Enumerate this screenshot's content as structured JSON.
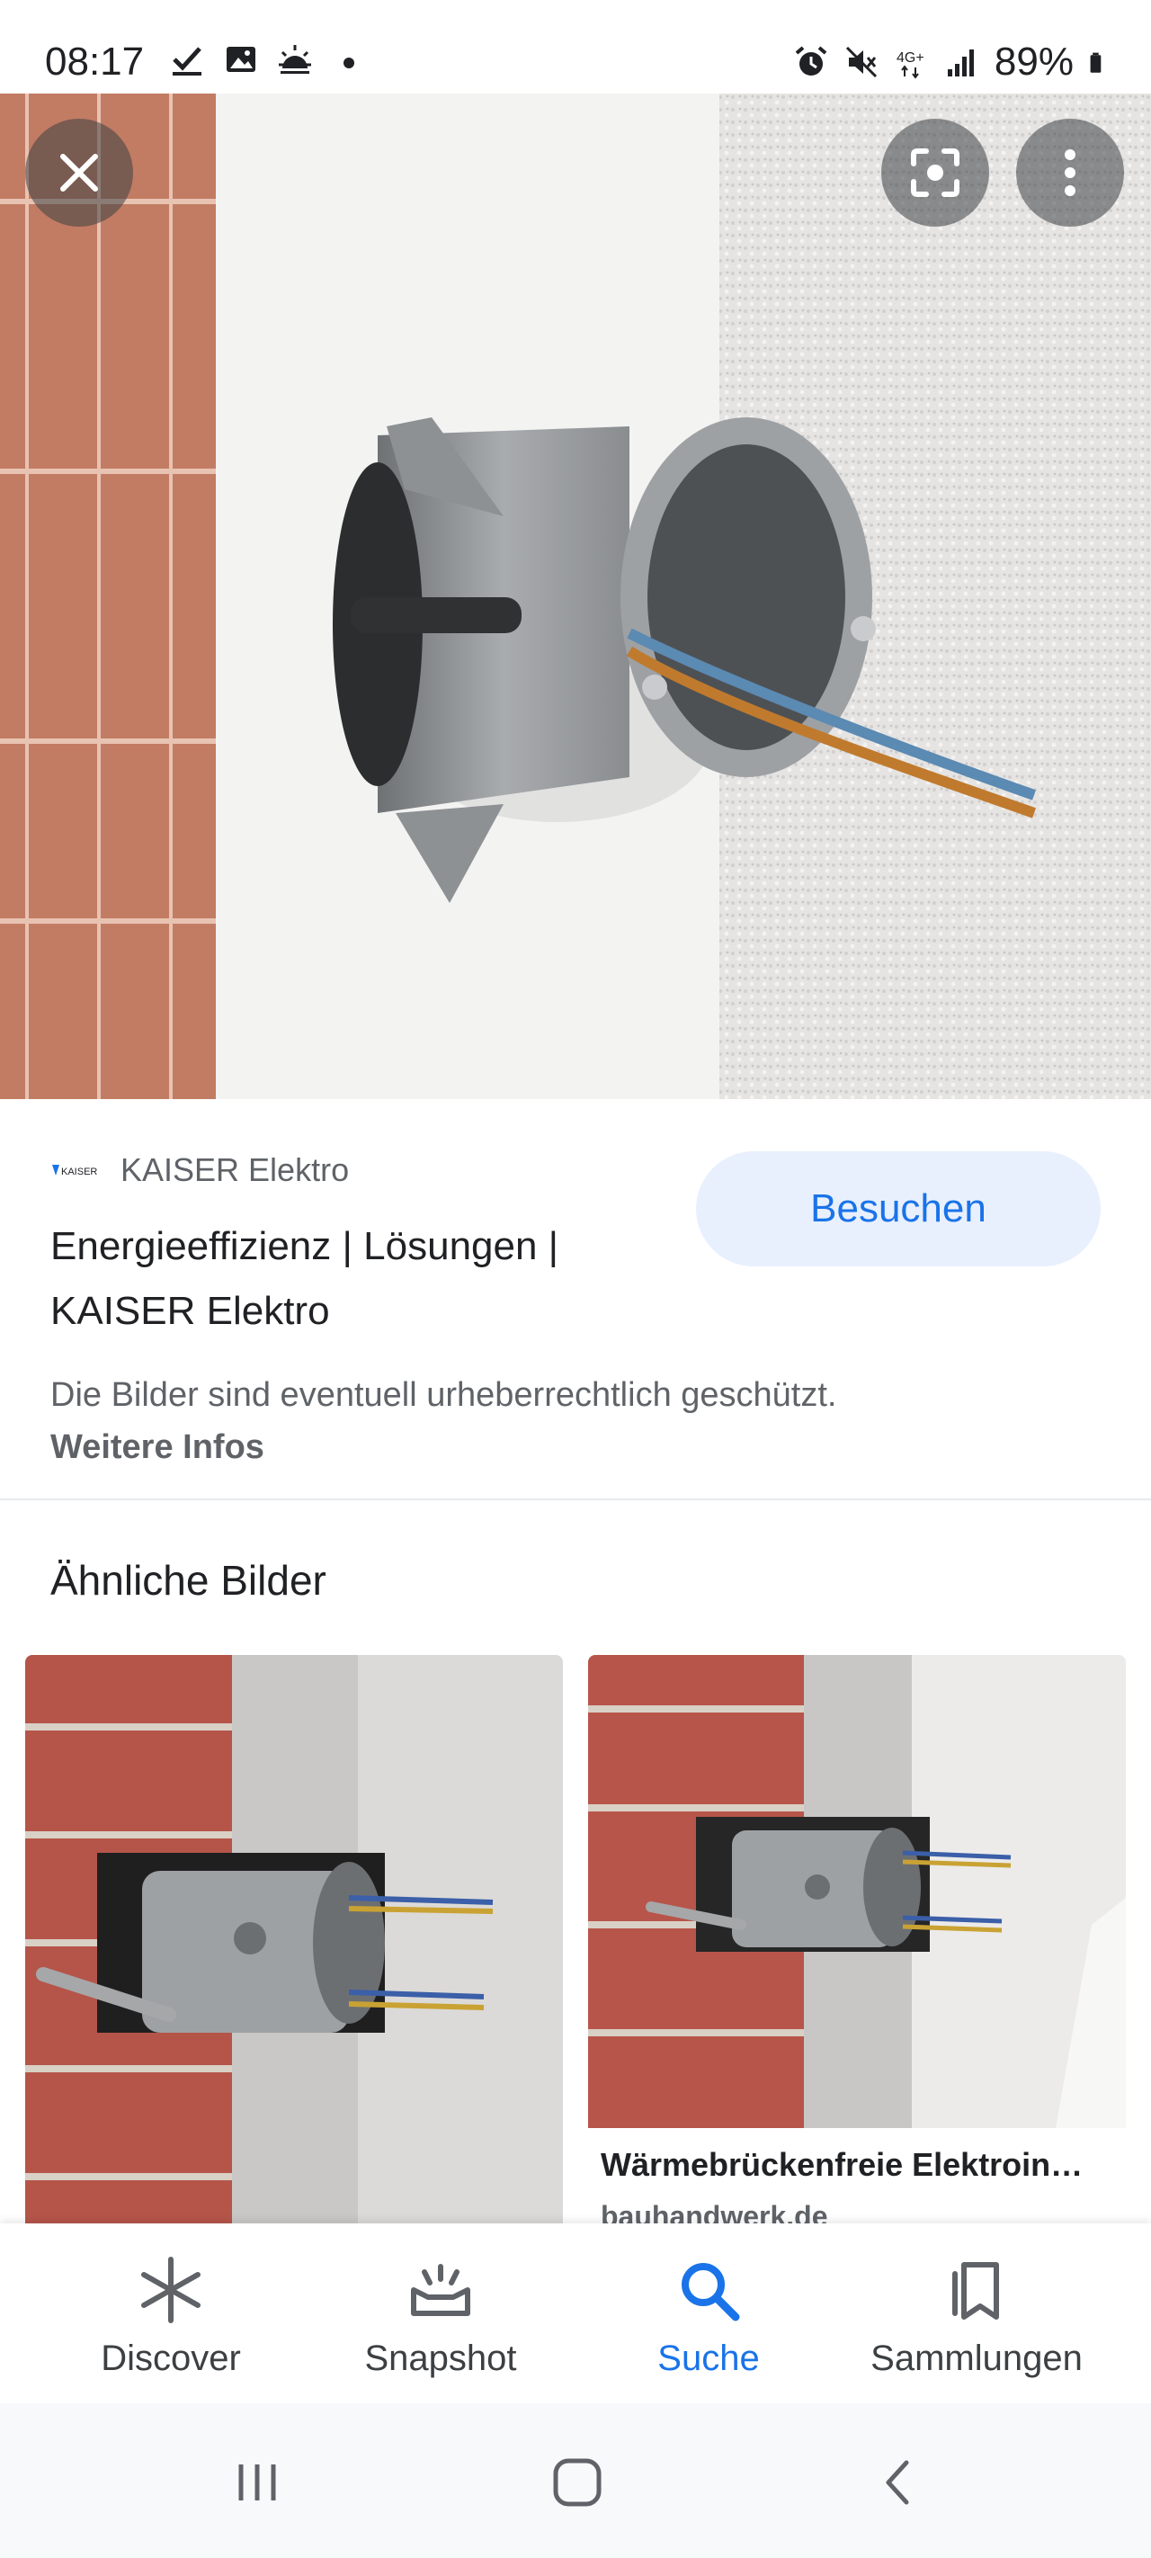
{
  "status_bar": {
    "time": "08:17",
    "battery": "89%",
    "network": "4G+",
    "icons_left": [
      "check-icon",
      "image-icon",
      "weather-icon",
      "dot-icon"
    ],
    "icons_right": [
      "alarm-icon",
      "mute-icon",
      "network-icon",
      "signal-icon",
      "battery-icon"
    ]
  },
  "result": {
    "source_name": "KAISER Elektro",
    "logo_text": "KAISER",
    "title": "Energieeffizienz | Lösungen | KAISER Elektro",
    "visit_label": "Besuchen",
    "copyright_text": "Die Bilder sind eventuell urheberrechtlich geschützt.",
    "more_info_label": "Weitere Infos"
  },
  "similar": {
    "heading": "Ähnliche Bilder",
    "items": [
      {
        "title": "",
        "site": ""
      },
      {
        "title": "Wärmebrückenfreie Elektroin…",
        "site": "bauhandwerk.de"
      }
    ]
  },
  "bottom_nav": {
    "items": [
      {
        "label": "Discover",
        "icon": "asterisk-icon",
        "active": false
      },
      {
        "label": "Snapshot",
        "icon": "snapshot-icon",
        "active": false
      },
      {
        "label": "Suche",
        "icon": "search-icon",
        "active": true
      },
      {
        "label": "Sammlungen",
        "icon": "collections-icon",
        "active": false
      }
    ]
  },
  "colors": {
    "accent": "#1a73e8",
    "visit_bg": "#e8f0fe",
    "text_primary": "#202124",
    "text_secondary": "#5f6368"
  }
}
